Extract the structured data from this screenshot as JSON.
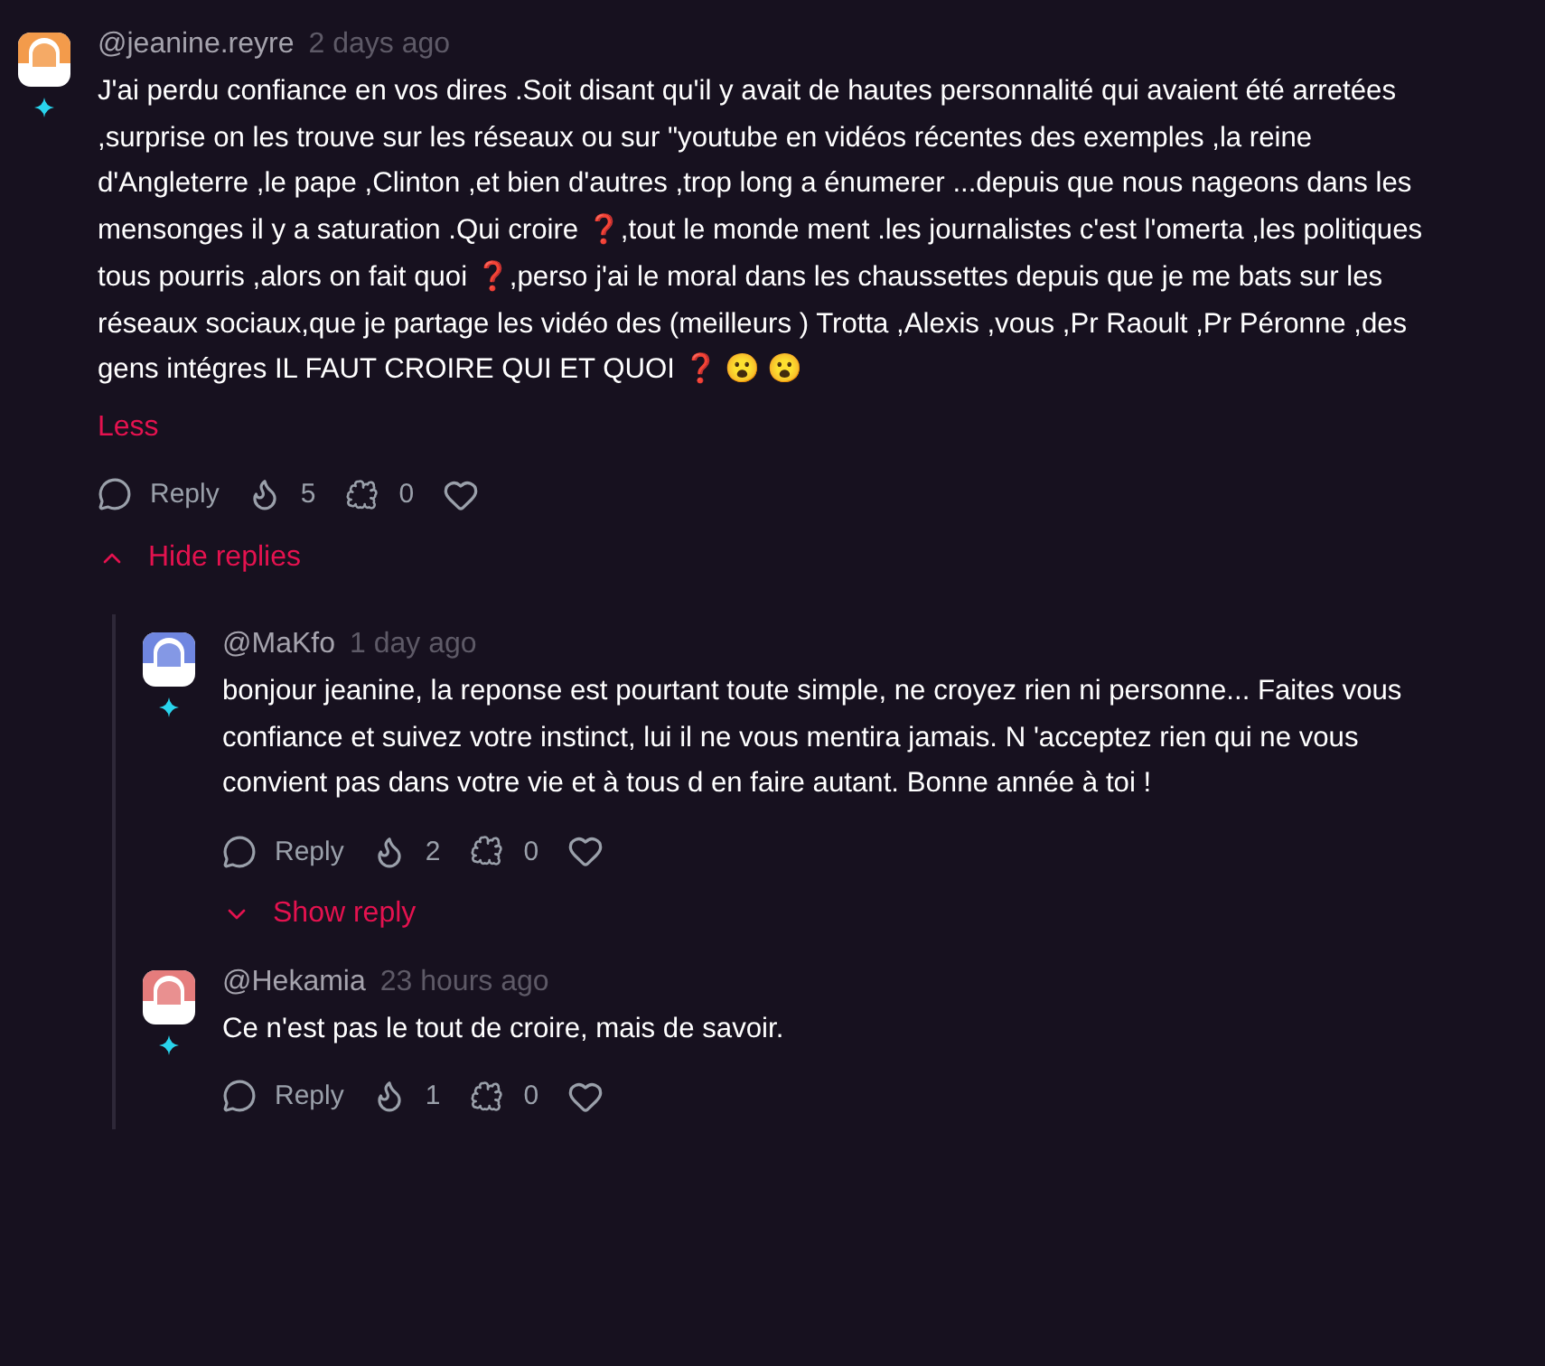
{
  "comment": {
    "author": "@jeanine.reyre",
    "time": "2 days ago",
    "color": "#f39b4b",
    "text": "J'ai perdu confiance en vos dires .Soit disant qu'il y avait de hautes personnalité qui avaient été arretées ,surprise on les trouve sur les réseaux ou sur \"youtube en vidéos récentes des exemples ,la reine d'Angleterre ,le pape ,Clinton ,et bien d'autres ,trop long a énumerer ...depuis que nous nageons dans les mensonges il y a saturation .Qui croire ❓,tout le monde ment .les journalistes c'est l'omerta ,les politiques tous pourris ,alors on fait quoi ❓,perso j'ai le moral dans les chaussettes depuis que je me bats sur les réseaux sociaux,que je partage les vidéo des (meilleurs ) Trotta ,Alexis ,vous ,Pr Raoult ,Pr Péronne ,des gens intégres IL FAUT CROIRE QUI ET QUOI ❓ 😮 😮",
    "less": "Less",
    "reply": "Reply",
    "fire": "5",
    "splat": "0",
    "toggle": {
      "label": "Hide replies",
      "expanded": true
    },
    "replies": [
      {
        "author": "@MaKfo",
        "time": "1 day ago",
        "color": "#6f86e0",
        "text": "bonjour jeanine, la reponse est pourtant toute simple, ne croyez rien ni personne... Faites vous confiance et suivez votre instinct, lui il ne vous mentira jamais. N 'acceptez rien qui ne vous convient pas dans votre vie et à tous d en faire autant. Bonne année à toi !",
        "reply": "Reply",
        "fire": "2",
        "splat": "0",
        "toggle": {
          "label": "Show reply",
          "expanded": false
        }
      },
      {
        "author": "@Hekamia",
        "time": "23 hours ago",
        "color": "#e57c7c",
        "text": "Ce n'est pas le tout de croire, mais de savoir.",
        "reply": "Reply",
        "fire": "1",
        "splat": "0"
      }
    ]
  }
}
